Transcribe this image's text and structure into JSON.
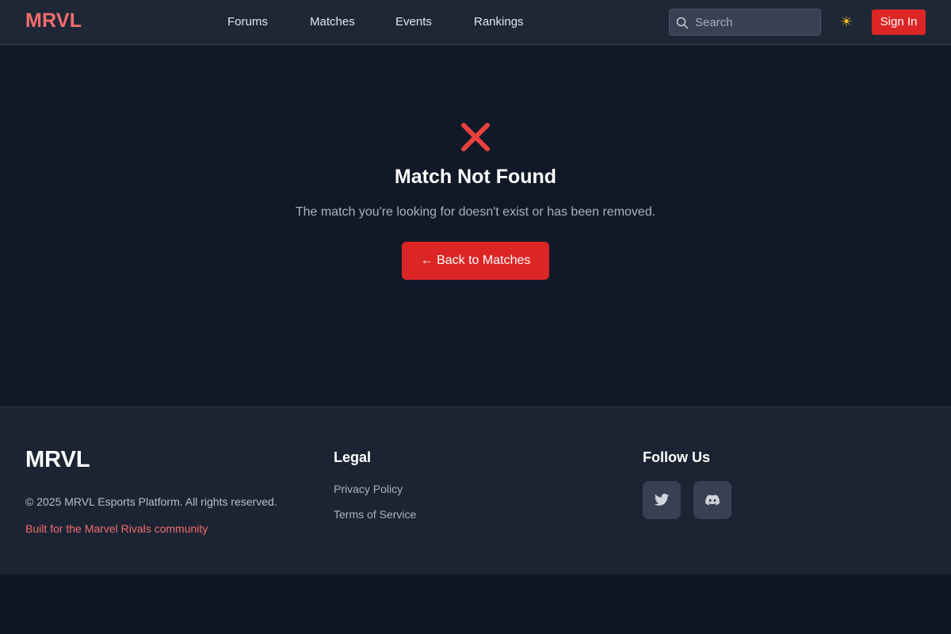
{
  "header": {
    "logo": "MRVL",
    "nav": [
      "Forums",
      "Matches",
      "Events",
      "Rankings"
    ],
    "search_placeholder": "Search",
    "theme_icon": "sun-icon",
    "sign_in_label": "Sign In"
  },
  "main": {
    "icon": "red-x-icon",
    "title": "Match Not Found",
    "message": "The match you're looking for doesn't exist or has been removed.",
    "back_label": "← Back to Matches"
  },
  "footer": {
    "logo": "MRVL",
    "copyright": "© 2025 MRVL Esports Platform. All rights reserved.",
    "tagline": "Built for the Marvel Rivals community",
    "legal_title": "Legal",
    "legal_links": [
      "Privacy Policy",
      "Terms of Service"
    ],
    "follow_title": "Follow Us",
    "social_icons": [
      "twitter-icon",
      "discord-icon"
    ]
  },
  "colors": {
    "accent": "#dc2626",
    "brand": "#f26d6d",
    "header_bg": "#1e2735",
    "page_bg": "#111827",
    "footer_bg": "#1c2433"
  }
}
